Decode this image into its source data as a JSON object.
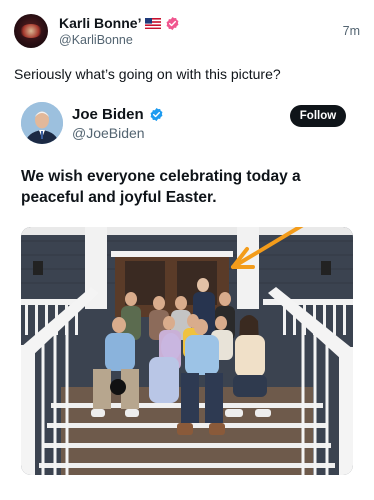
{
  "post": {
    "display_name": "Karli Bonne’",
    "handle": "@KarliBonne",
    "time": "7m",
    "text": "Seriously what’s going on with this picture?",
    "flag_icon": "us-flag-icon",
    "verified_icon": "verified-badge-pink-icon"
  },
  "quote": {
    "display_name": "Joe Biden",
    "handle": "@JoeBiden",
    "follow_label": "Follow",
    "text": "We wish everyone celebrating today a peaceful and joyful Easter.",
    "verified_icon": "verified-badge-blue-icon"
  },
  "photo": {
    "annotation": "orange-arrow",
    "colors": {
      "arrow": "#f39c1b",
      "house_siding": "#3b4350",
      "railing": "#f2f2f2",
      "steps": "#6e5a4b"
    }
  }
}
